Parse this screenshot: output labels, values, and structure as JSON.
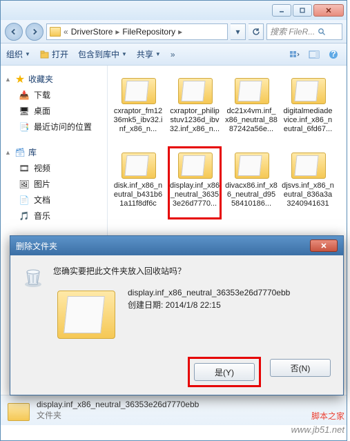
{
  "breadcrumb": {
    "seg1": "DriverStore",
    "seg2": "FileRepository"
  },
  "search": {
    "placeholder": "搜索 FileR..."
  },
  "toolbar": {
    "organize": "组织",
    "open": "打开",
    "include": "包含到库中",
    "share": "共享"
  },
  "sidebar": {
    "favorites": "收藏夹",
    "fav_items": [
      "下载",
      "桌面",
      "最近访问的位置"
    ],
    "libraries": "库",
    "lib_items": [
      "视频",
      "图片",
      "文档",
      "音乐"
    ]
  },
  "folders": [
    "cxraptor_fm1236mk5_ibv32.inf_x86_n...",
    "cxraptor_philipstuv1236d_ibv32.inf_x86_n...",
    "dc21x4vm.inf_x86_neutral_8887242a56e...",
    "digitalmediadevice.inf_x86_neutral_6fd67...",
    "disk.inf_x86_neutral_b431b61a11f8df6c",
    "display.inf_x86_neutral_36353e26d7770...",
    "divacx86.inf_x86_neutral_d9558410186...",
    "djsvs.inf_x86_neutral_836a3a3240941631"
  ],
  "dialog": {
    "title": "删除文件夹",
    "question": "您确实要把此文件夹放入回收站吗？",
    "filename": "display.inf_x86_neutral_36353e26d7770ebb",
    "created_label": "创建日期: ",
    "created_value": "2014/1/8 22:15",
    "yes": "是(Y)",
    "no": "否(N)"
  },
  "status": {
    "name": "display.inf_x86_neutral_36353e26d7770ebb",
    "type": "文件夹"
  },
  "watermark": {
    "brand": "脚本之家",
    "url": "www.jb51.net"
  }
}
